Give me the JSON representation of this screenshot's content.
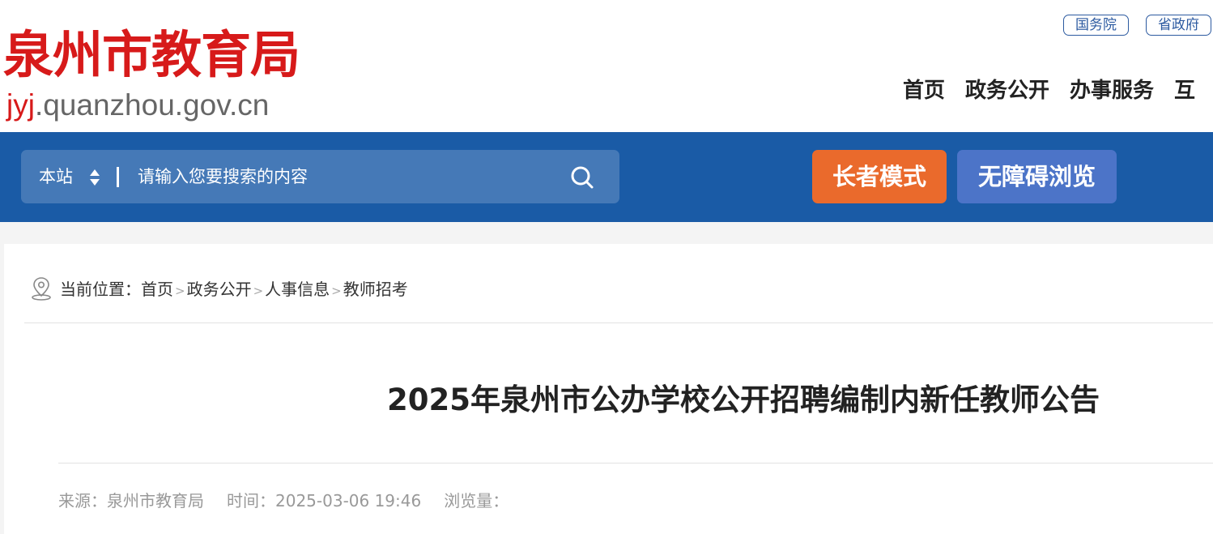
{
  "header": {
    "logo_cn": "泉州市教育局",
    "logo_url_highlight": "jyj",
    "logo_url_rest": ".quanzhou.gov.cn",
    "top_links": [
      "国务院",
      "省政府"
    ],
    "nav": [
      "首页",
      "政务公开",
      "办事服务",
      "互"
    ]
  },
  "search": {
    "scope": "本站",
    "placeholder": "请输入您要搜索的内容"
  },
  "modes": {
    "elder": "长者模式",
    "accessible": "无障碍浏览"
  },
  "breadcrumb": {
    "label": "当前位置：",
    "items": [
      "首页",
      "政务公开",
      "人事信息",
      "教师招考"
    ],
    "separator": ">"
  },
  "article": {
    "title": "2025年泉州市公办学校公开招聘编制内新任教师公告",
    "source": "来源：泉州市教育局",
    "time": "时间：2025-03-06 19:46",
    "views": "浏览量："
  },
  "colors": {
    "logo_red": "#d71a1a",
    "bar_blue": "#1a5ba6",
    "elder_orange": "#ea6a2c",
    "accessible_blue": "#4c74c8"
  }
}
